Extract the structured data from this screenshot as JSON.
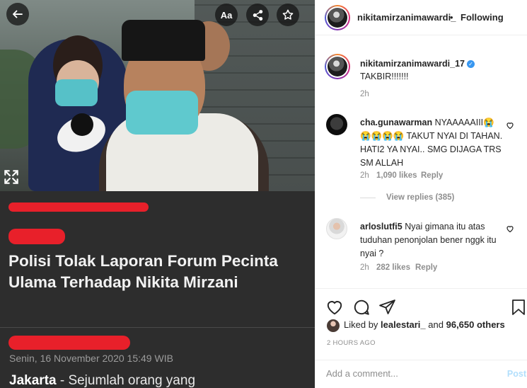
{
  "media": {
    "font_button_label": "Aa",
    "headline": "Polisi Tolak Laporan Forum Pecinta Ulama Terhadap Nikita Mirzani",
    "dateline": "Senin, 16 November 2020 15:49 WIB",
    "lede_place": "Jakarta",
    "lede_rest": " - Sejumlah orang yang",
    "redaction_color": "#e8202a"
  },
  "header": {
    "username": "nikitamirzanimawardi_",
    "separator": "•",
    "follow_status": "Following"
  },
  "caption": {
    "username": "nikitamirzanimawardi_17",
    "verified_icon": "check",
    "text": "TAKBIR!!!!!!!",
    "time": "2h"
  },
  "comments": [
    {
      "username": "cha.gunawarman",
      "text": "NYAAAAAIII😭😭😭😭😭 TAKUT NYAI DI TAHAN. HATI2 YA NYAI.. SMG DIJAGA TRS SM ALLAH",
      "time": "2h",
      "likes": "1,090 likes",
      "reply_label": "Reply",
      "view_replies": "View replies (385)"
    },
    {
      "username": "arloslutfi5",
      "text": "Nyai gimana itu atas tuduhan penonjolan bener nggk itu nyai ?",
      "time": "2h",
      "likes": "282 likes",
      "reply_label": "Reply"
    }
  ],
  "likes": {
    "prefix": "Liked by",
    "user": "lealestari_",
    "and": "and",
    "others": "96,650 others"
  },
  "post_time": "2 HOURS AGO",
  "add_comment": {
    "placeholder": "Add a comment...",
    "post_label": "Post"
  },
  "colors": {
    "link_blue": "#3897f0",
    "post_disabled": "#b2dffc",
    "muted": "#8e8e8e"
  }
}
